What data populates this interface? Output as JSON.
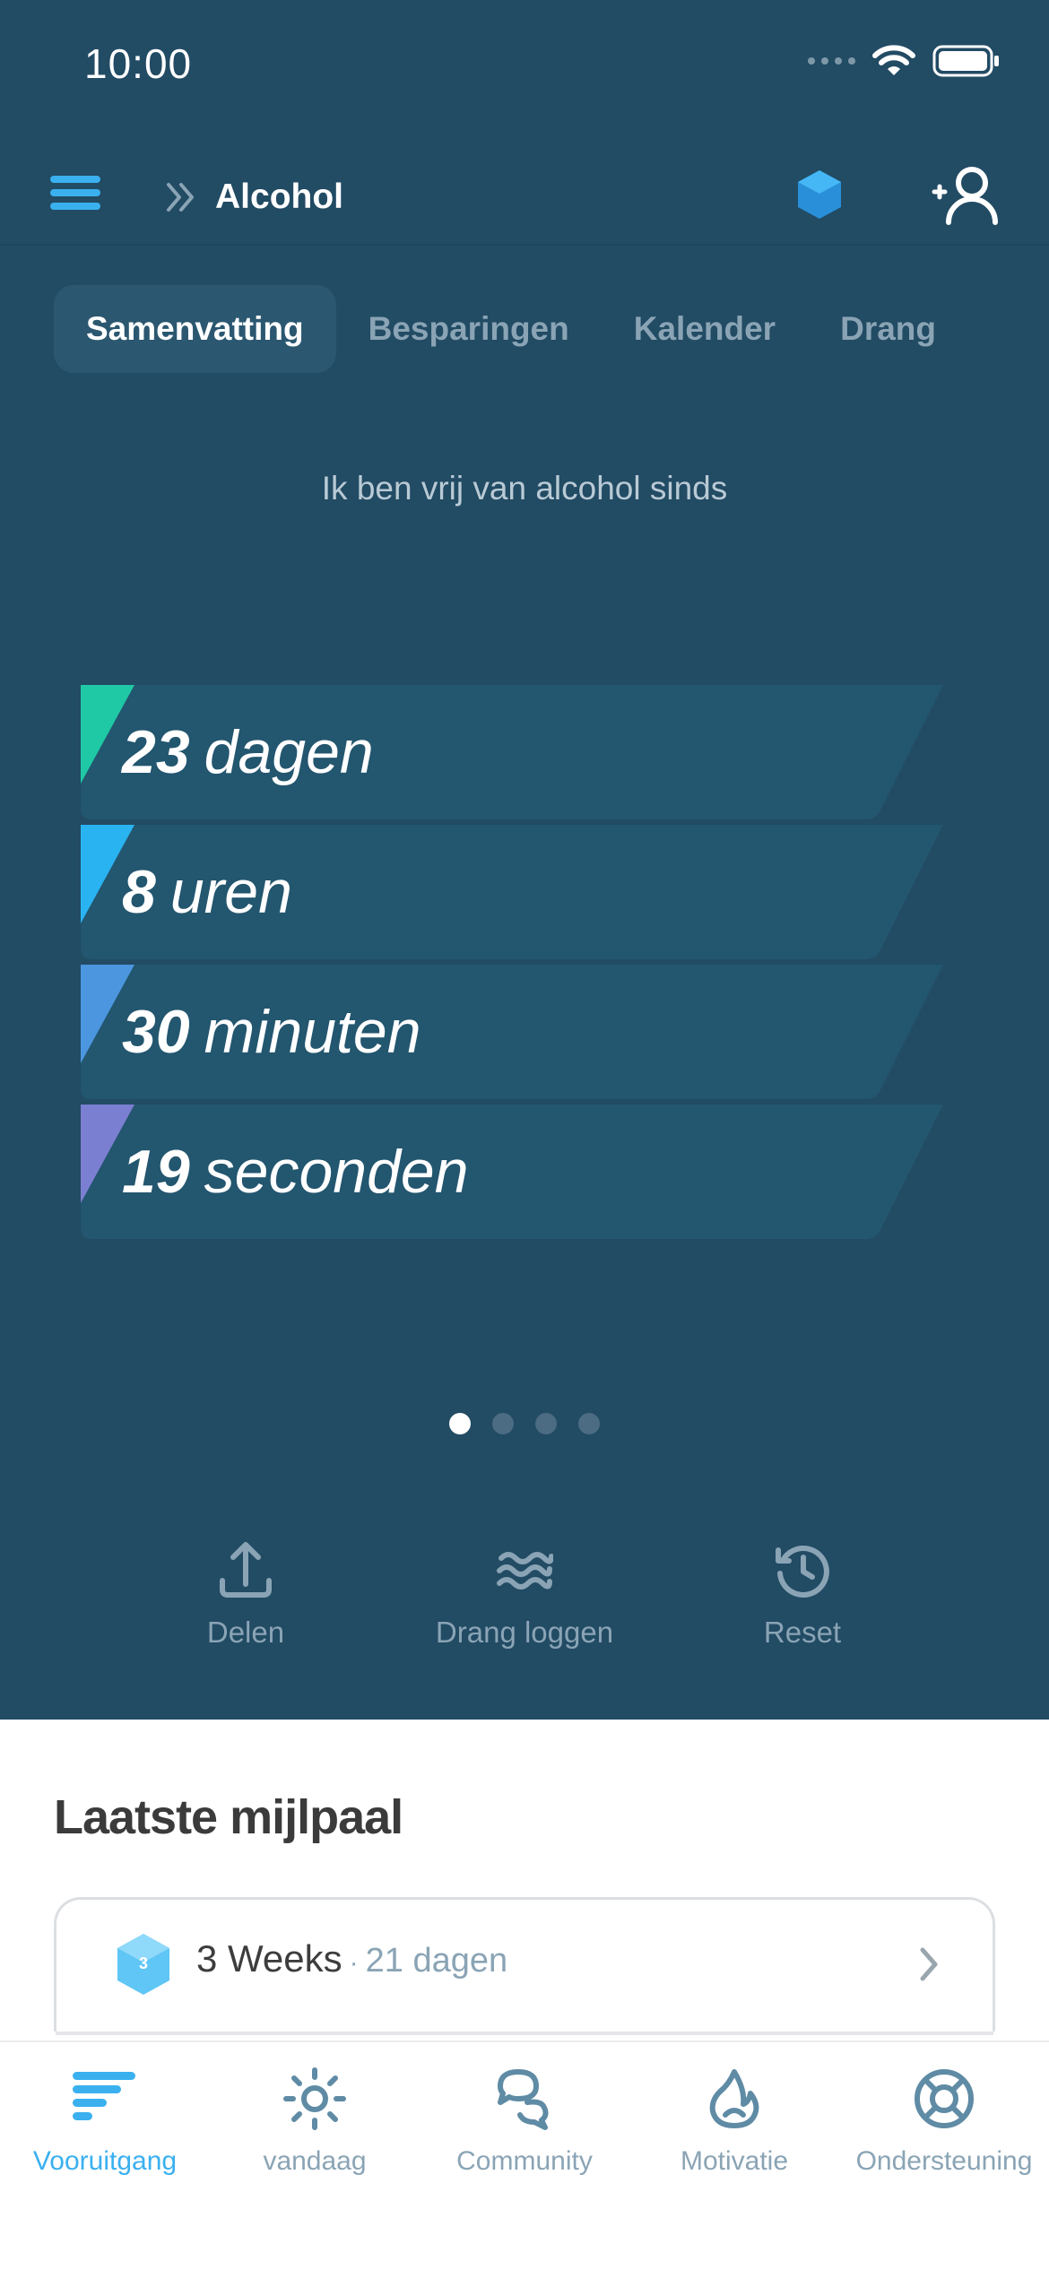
{
  "status_bar": {
    "time": "10:00"
  },
  "header": {
    "title": "Alcohol"
  },
  "tabs": [
    {
      "label": "Samenvatting",
      "active": true
    },
    {
      "label": "Besparingen",
      "active": false
    },
    {
      "label": "Kalender",
      "active": false
    },
    {
      "label": "Drang",
      "active": false
    }
  ],
  "intro_text": "Ik ben vrij van alcohol sinds",
  "counters": [
    {
      "value": "23",
      "unit": "dagen",
      "accent": "#1fc9a5"
    },
    {
      "value": "8",
      "unit": "uren",
      "accent": "#2ab3f1"
    },
    {
      "value": "30",
      "unit": "minuten",
      "accent": "#4b96df"
    },
    {
      "value": "19",
      "unit": "seconden",
      "accent": "#7b7fd1"
    }
  ],
  "pager": {
    "current": 1,
    "total": 4
  },
  "actions": {
    "share": "Delen",
    "log_craving": "Drang loggen",
    "reset": "Reset"
  },
  "milestone": {
    "section_title": "Laatste mijlpaal",
    "badge_number": "3",
    "name": "3 Weeks",
    "separator": "·",
    "days": "21 dagen"
  },
  "nav": [
    {
      "label": "Vooruitgang",
      "icon": "progress-bars-icon",
      "active": true
    },
    {
      "label": "vandaag",
      "icon": "sun-icon",
      "active": false
    },
    {
      "label": "Community",
      "icon": "chat-bubbles-icon",
      "active": false
    },
    {
      "label": "Motivatie",
      "icon": "flame-icon",
      "active": false
    },
    {
      "label": "Ondersteuning",
      "icon": "lifebuoy-icon",
      "active": false
    }
  ],
  "colors": {
    "background": "#224b64",
    "accent": "#3ab0ef",
    "muted": "#8aa4b5"
  }
}
